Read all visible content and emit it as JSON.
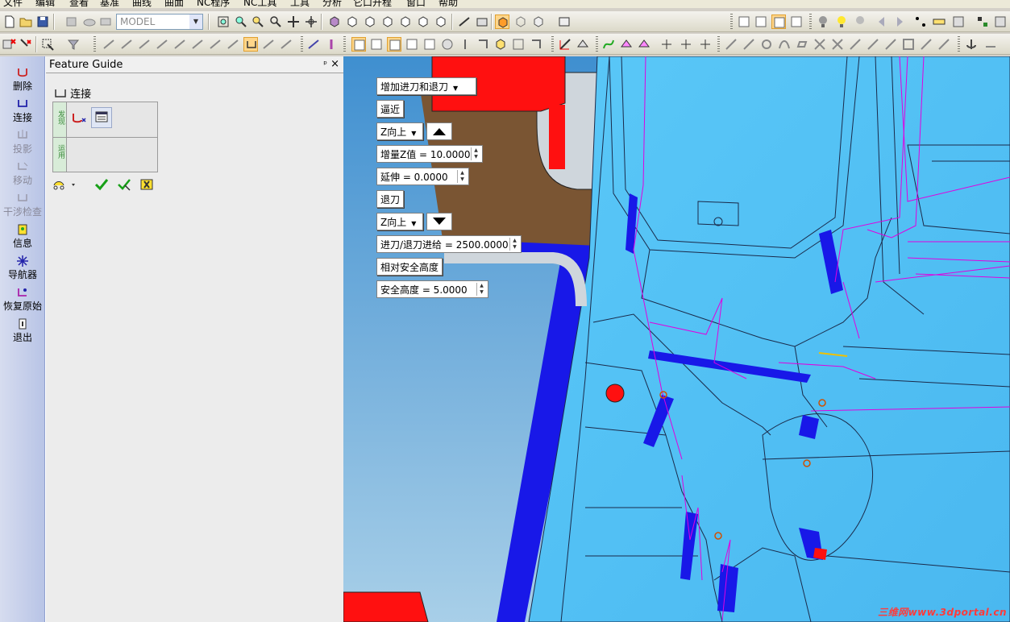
{
  "menu": [
    "文件",
    "编辑",
    "查看",
    "基准",
    "曲线",
    "曲面",
    "NC程序",
    "NC工具",
    "工具",
    "分析",
    "它口开程",
    "窗口",
    "帮助"
  ],
  "toolbar": {
    "model_combo": "MODEL"
  },
  "leftbar": [
    {
      "label": "删除",
      "icon": "delete-icon",
      "enabled": true
    },
    {
      "label": "连接",
      "icon": "connect-icon",
      "enabled": true
    },
    {
      "label": "投影",
      "icon": "project-icon",
      "enabled": false
    },
    {
      "label": "移动",
      "icon": "move-icon",
      "enabled": false
    },
    {
      "label": "干涉检查",
      "icon": "interference-icon",
      "enabled": false
    },
    {
      "label": "信息",
      "icon": "info-icon",
      "enabled": true
    },
    {
      "label": "导航器",
      "icon": "navigator-icon",
      "enabled": true
    },
    {
      "label": "恢复原始",
      "icon": "restore-icon",
      "enabled": true
    },
    {
      "label": "退出",
      "icon": "exit-icon",
      "enabled": true
    }
  ],
  "panel": {
    "title": "Feature Guide",
    "pin": "ᵖ",
    "close": "×",
    "feature": "连接",
    "grid_col1": "发现",
    "grid_col2": "运用"
  },
  "overlay": {
    "add_dropdown": "增加进刀和退刀",
    "approach": "逼近",
    "approach_dir": "Z向上",
    "inc_z": "增量Z值 = 10.0000",
    "extend": "延伸 =   0.0000",
    "retract": "退刀",
    "retract_dir": "Z向上",
    "feed": "进刀/退刀进给 = 2500.0000",
    "rel_safe": "相对安全高度",
    "safe_height": "安全高度 =   5.0000"
  },
  "watermark": "三维网www.3dportal.cn",
  "colors": {
    "viewport_bg": "#58c4f4",
    "part_blue": "#2020e0",
    "toolpath": "#e000e0",
    "accent_red": "#ff0000"
  }
}
